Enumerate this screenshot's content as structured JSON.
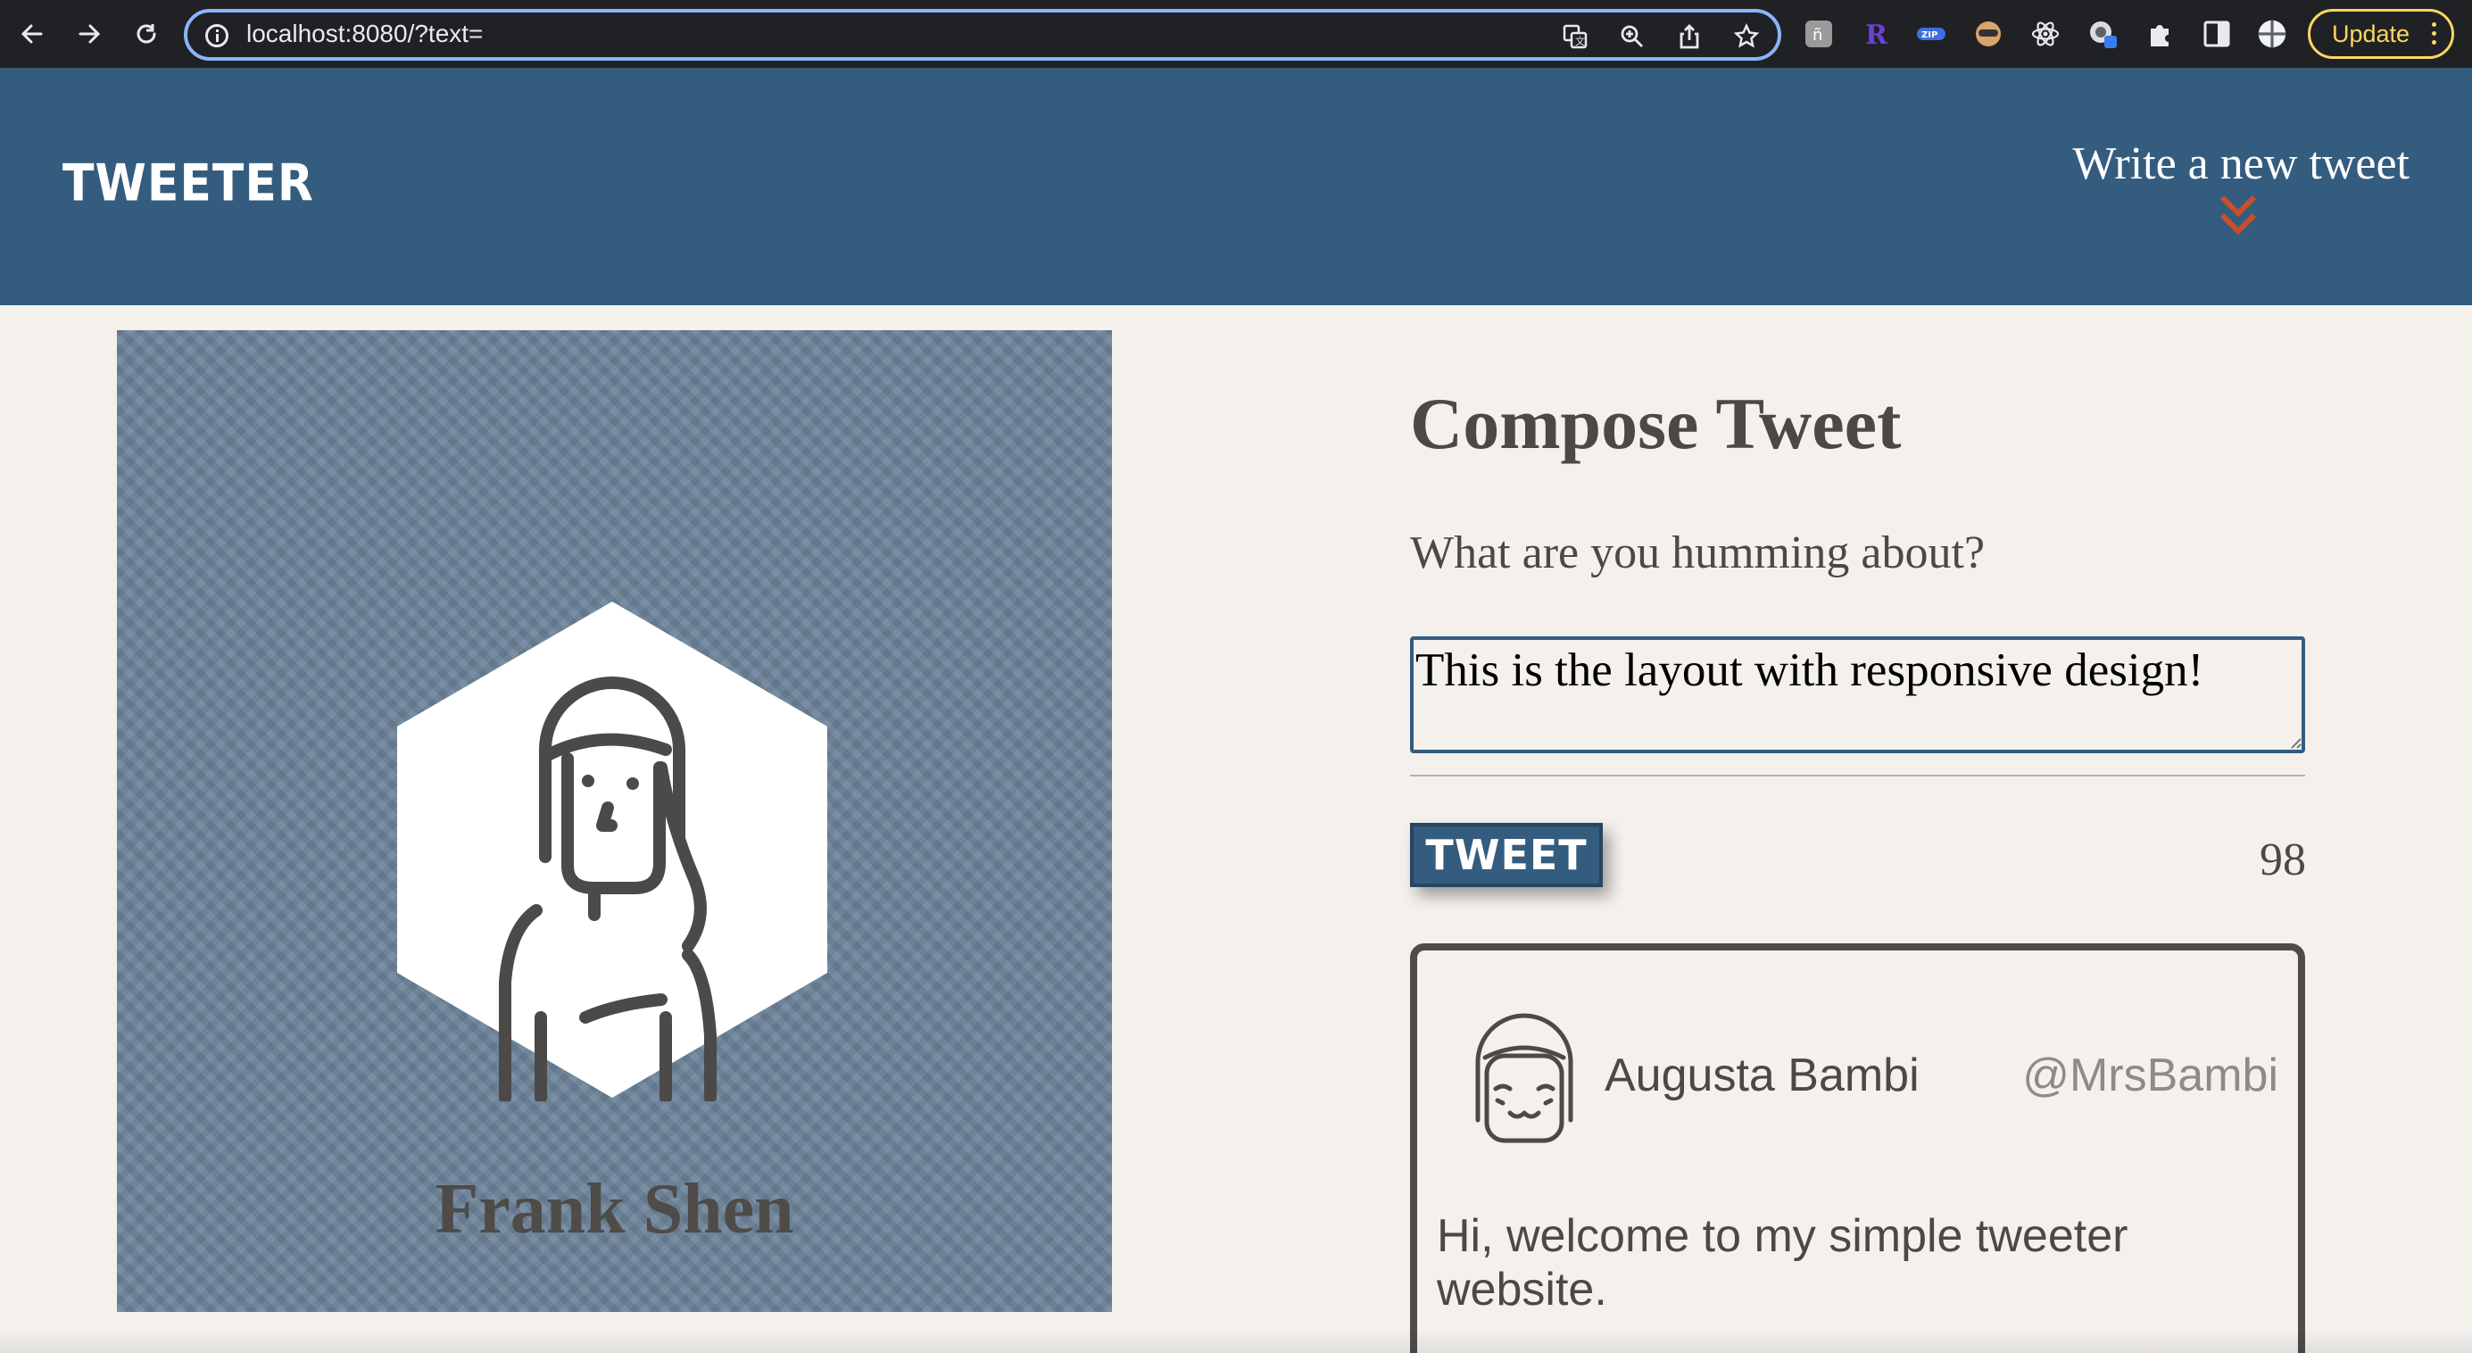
{
  "browser": {
    "url": "localhost:8080/?text=",
    "update_label": "Update"
  },
  "header": {
    "brand": "TWEETER",
    "write_new": "Write a new tweet",
    "accent_color": "#c94f2b",
    "bg_color": "#345c7f"
  },
  "profile": {
    "name": "Frank Shen"
  },
  "compose": {
    "title": "Compose Tweet",
    "prompt": "What are you humming about?",
    "text": "This is the layout with responsive design!",
    "button_label": "TWEET",
    "counter": "98"
  },
  "tweet": {
    "name": "Augusta Bambi",
    "handle": "@MrsBambi",
    "body": "Hi, welcome to my simple tweeter website."
  }
}
